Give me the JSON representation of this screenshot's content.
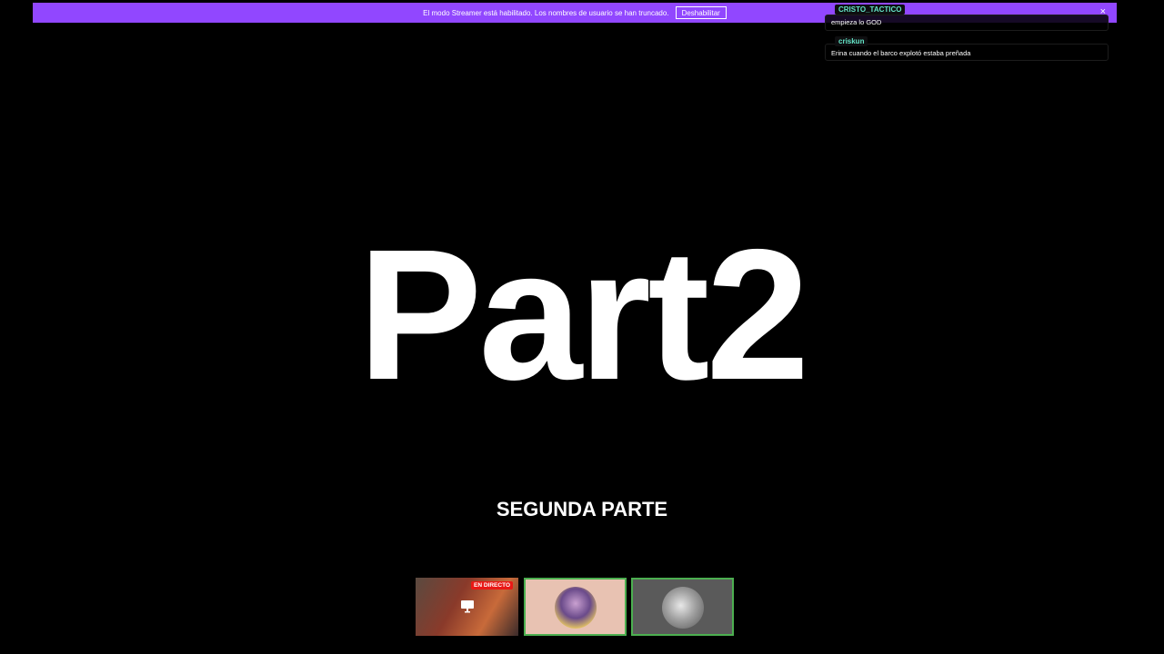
{
  "banner": {
    "message": "El modo Streamer está habilitado. Los nombres de usuario se han truncado.",
    "button_label": "Deshabilitar",
    "close_glyph": "×",
    "background": "#9147ff"
  },
  "chat": {
    "messages": [
      {
        "username": "CRISTO_TACTICO",
        "text": "empieza lo GOD"
      },
      {
        "username": "criskun",
        "text": "Erina cuando el barco explotó estaba preñada"
      }
    ],
    "username_color": "#64e6c8"
  },
  "main": {
    "title": "Part2",
    "subtitle": "SEGUNDA PARTE"
  },
  "thumbnails": {
    "live_label": "EN DIRECTO",
    "items": [
      {
        "icon": "screen-icon",
        "live": true
      },
      {
        "icon": "avatar-image",
        "selected": true
      },
      {
        "icon": "avatar-image",
        "selected": true
      }
    ],
    "live_color": "#e91916",
    "selected_border": "#4caf50"
  }
}
